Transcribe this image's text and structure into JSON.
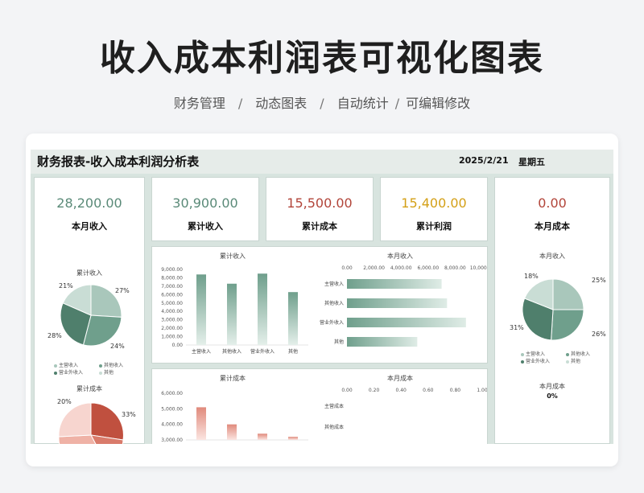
{
  "page": {
    "title": "收入成本利润表可视化图表",
    "tags": [
      "财务管理",
      "动态图表",
      "自动统计",
      "可编辑修改"
    ],
    "separator": "/"
  },
  "report": {
    "title": "财务报表-收入成本利润分析表",
    "date": "2025/2/21",
    "weekday": "星期五"
  },
  "kpis": {
    "month_income": {
      "value": "28,200.00",
      "label": "本月收入",
      "color": "#5a8a78"
    },
    "total_income": {
      "value": "30,900.00",
      "label": "累计收入",
      "color": "#5a8a78"
    },
    "total_cost": {
      "value": "15,500.00",
      "label": "累计成本",
      "color": "#b2453a"
    },
    "total_profit": {
      "value": "15,400.00",
      "label": "累计利润",
      "color": "#d4a017"
    },
    "month_cost": {
      "value": "0.00",
      "label": "本月成本",
      "color": "#b2453a"
    }
  },
  "left_pies": {
    "income_title": "累计收入",
    "income_pcts": [
      "27%",
      "24%",
      "28%",
      "21%"
    ],
    "legend": [
      "主营收入",
      "其他收入",
      "营业外收入",
      "其他"
    ],
    "cost_title": "累计成本",
    "cost_pcts": [
      "20%",
      "33%"
    ]
  },
  "right_pies": {
    "income_title": "本月收入",
    "income_pcts": [
      "25%",
      "26%",
      "31%",
      "18%"
    ],
    "legend": [
      "主营收入",
      "其他收入",
      "营业外收入",
      "其他"
    ],
    "cost_title": "本月成本",
    "cost_pct": "0%"
  },
  "chart_data": [
    {
      "type": "bar",
      "title": "累计收入",
      "categories": [
        "主营收入",
        "其他收入",
        "营业外收入",
        "其他"
      ],
      "values": [
        8400,
        7300,
        8500,
        6300
      ],
      "ylim": [
        0,
        9000
      ],
      "yticks": [
        "9,000.00",
        "8,000.00",
        "7,000.00",
        "6,000.00",
        "5,000.00",
        "4,000.00",
        "3,000.00",
        "2,000.00",
        "1,000.00",
        "0.00"
      ]
    },
    {
      "type": "bar",
      "orientation": "horizontal",
      "title": "本月收入",
      "categories": [
        "主营收入",
        "其他收入",
        "营业外收入",
        "其他"
      ],
      "values": [
        7000,
        7400,
        8800,
        5200
      ],
      "xlim": [
        0,
        10000
      ],
      "xticks": [
        "0.00",
        "2,000.00",
        "4,000.00",
        "6,000.00",
        "8,000.00",
        "10,000.00"
      ]
    },
    {
      "type": "bar",
      "title": "累计成本",
      "categories": [
        "",
        "",
        "",
        ""
      ],
      "values": [
        5100,
        4000,
        3400,
        3200
      ],
      "ylim": [
        3000,
        6000
      ],
      "yticks": [
        "6,000.00",
        "5,000.00",
        "4,000.00",
        "3,000.00"
      ]
    },
    {
      "type": "bar",
      "orientation": "horizontal",
      "title": "本月成本",
      "categories": [
        "主营成本",
        "其他成本"
      ],
      "values": [
        0,
        0
      ],
      "xlim": [
        0,
        1
      ],
      "xticks": [
        "0.00",
        "0.20",
        "0.40",
        "0.60",
        "0.80",
        "1.00"
      ]
    }
  ]
}
